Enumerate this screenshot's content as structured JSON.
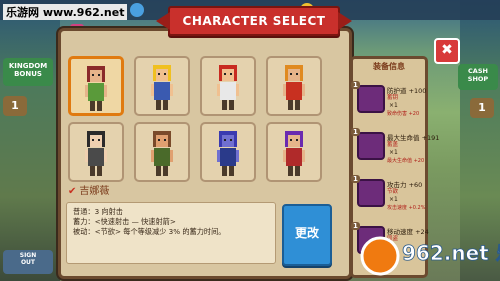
{
  "watermark": "乐游网 www.962.net",
  "title": "CHARACTER SELECT",
  "side_left": {
    "top_label": "KINGDOM\nBONUS",
    "bottom_label": "SIGN\nOUT",
    "num": "1"
  },
  "side_right": {
    "top_label": "CASH\nSHOP",
    "num": "1"
  },
  "characters": [
    {
      "id": "c1",
      "hair": "#8a2a2a",
      "skin": "#e6b48a",
      "body": "#5a9a3a",
      "selected": true
    },
    {
      "id": "c2",
      "hair": "#f0c020",
      "skin": "#f0c090",
      "body": "#3a5ab0",
      "selected": false
    },
    {
      "id": "c3",
      "hair": "#c82a20",
      "skin": "#f0c090",
      "body": "#e8e8e8",
      "selected": false
    },
    {
      "id": "c4",
      "hair": "#e08a20",
      "skin": "#e6b48a",
      "body": "#c83020",
      "selected": false
    },
    {
      "id": "c5",
      "hair": "#2a2a2a",
      "skin": "#f0d0b0",
      "body": "#4a4a4a",
      "selected": false
    },
    {
      "id": "c6",
      "hair": "#7a4a2a",
      "skin": "#e0a070",
      "body": "#4a6a2a",
      "selected": false
    },
    {
      "id": "c7",
      "hair": "#3a3ab0",
      "skin": "#7070d0",
      "body": "#2a3a8a",
      "selected": false
    },
    {
      "id": "c8",
      "hair": "#6a2ab0",
      "skin": "#e6b48a",
      "body": "#b02a2a",
      "selected": false
    }
  ],
  "selected_name": "吉娜薇",
  "description": [
    "普通：3 向射击",
    "蓄力：<快速射击 — 快速射箭>",
    "被动：<节欲> 每个等级减少 3% 的蓄力时间。"
  ],
  "change_button": "更改",
  "equip": {
    "title": "装备信息",
    "items": [
      {
        "name": "防护道 +100",
        "sub": "蓄钥",
        "lvl": "×1",
        "small": "致命伤害 +20",
        "badge": "1"
      },
      {
        "name": "最大生命值 +191",
        "sub": "蓄盖",
        "lvl": "×1",
        "small": "最大生命值 +20",
        "badge": "1"
      },
      {
        "name": "攻击力 +60",
        "sub": "节欲",
        "lvl": "×1",
        "small": "攻击速度 +0.2%",
        "badge": "1"
      },
      {
        "name": "移动速度 +24",
        "sub": "同盗",
        "lvl": "",
        "small": "",
        "badge": "1"
      }
    ]
  },
  "close_icon": "✖",
  "watermark2": "962.net 乐游网",
  "colors": {
    "accent": "#c9302c",
    "button": "#2f8fd6"
  }
}
